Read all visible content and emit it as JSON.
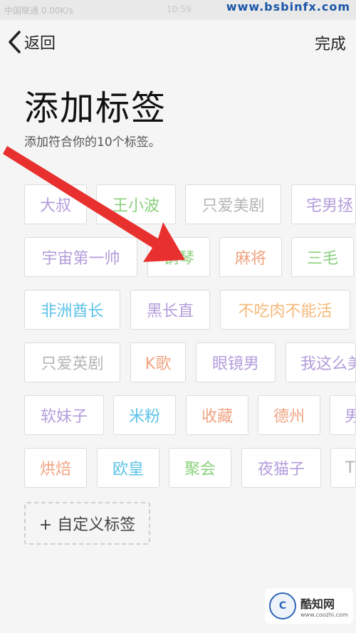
{
  "statusbar": {
    "left_text": "中国联通 0.00K/s",
    "time": "10:59"
  },
  "watermark": "www.bsbinfx.com",
  "header": {
    "back_label": "返回",
    "done_label": "完成"
  },
  "page": {
    "title": "添加标签",
    "subtitle": "添加符合你的10个标签。"
  },
  "tags": [
    {
      "label": "大叔",
      "color": "#b39ddb"
    },
    {
      "label": "王小波",
      "color": "#8bd17c"
    },
    {
      "label": "只爱美剧",
      "color": "#b5b5b5"
    },
    {
      "label": "宅男拯",
      "color": "#b39ddb"
    },
    {
      "label": "宇宙第一帅",
      "color": "#b39ddb"
    },
    {
      "label": "钢琴",
      "color": "#8bd17c"
    },
    {
      "label": "麻将",
      "color": "#f0a482"
    },
    {
      "label": "三毛",
      "color": "#8bd17c"
    },
    {
      "label": "非洲酋长",
      "color": "#5bc2e7"
    },
    {
      "label": "黑长直",
      "color": "#b39ddb"
    },
    {
      "label": "不吃肉不能活",
      "color": "#f5b97a"
    },
    {
      "label": "只爱英剧",
      "color": "#b5b5b5"
    },
    {
      "label": "K歌",
      "color": "#f0a482"
    },
    {
      "label": "眼镜男",
      "color": "#b39ddb"
    },
    {
      "label": "我这么美",
      "color": "#b39ddb"
    },
    {
      "label": "软妹子",
      "color": "#b39ddb"
    },
    {
      "label": "米粉",
      "color": "#5bc2e7"
    },
    {
      "label": "收藏",
      "color": "#f0a482"
    },
    {
      "label": "德州",
      "color": "#f0a482"
    },
    {
      "label": "男",
      "color": "#b39ddb"
    },
    {
      "label": "烘焙",
      "color": "#f0a482"
    },
    {
      "label": "欧皇",
      "color": "#5bc2e7"
    },
    {
      "label": "聚会",
      "color": "#8bd17c"
    },
    {
      "label": "夜猫子",
      "color": "#b39ddb"
    },
    {
      "label": "TV",
      "color": "#b5b5b5"
    }
  ],
  "add_tag_label": "+ 自定义标签",
  "logo": {
    "name": "酷知网",
    "url": "www.coozhi.com",
    "circle_text": "C"
  },
  "colors": {
    "arrow": "#e8312f",
    "background": "#f5f5f5"
  }
}
